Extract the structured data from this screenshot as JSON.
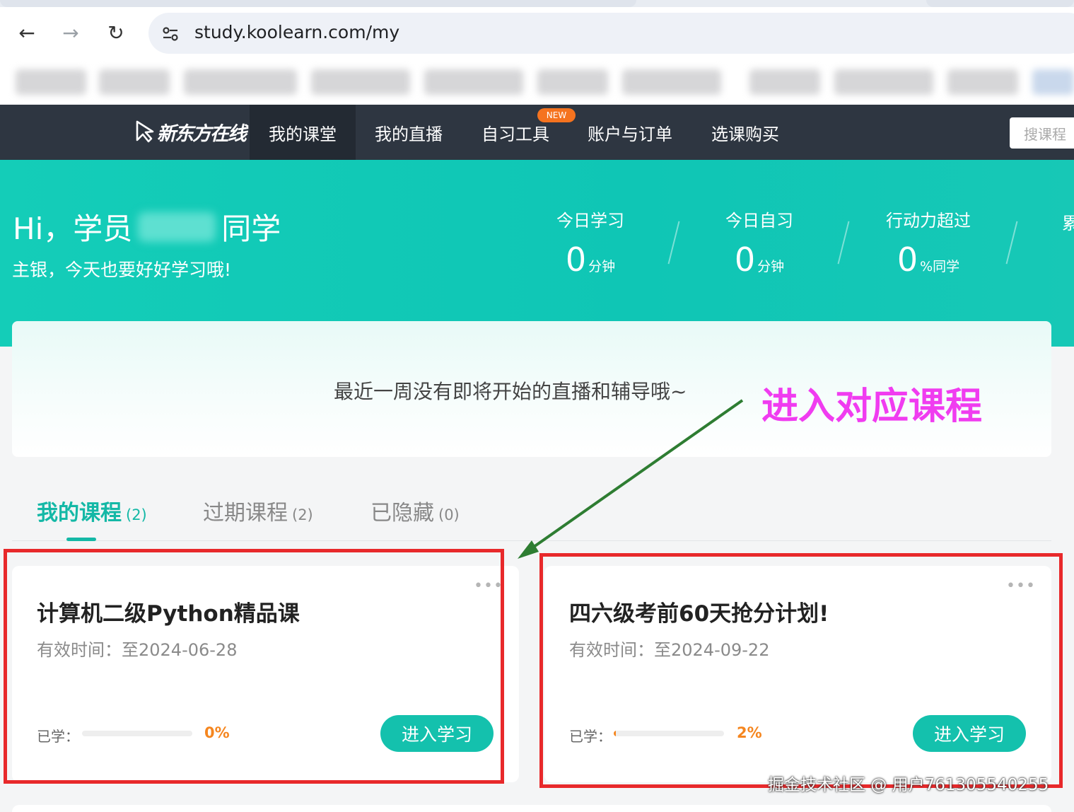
{
  "browser": {
    "url": "study.koolearn.com/my",
    "back_icon": "←",
    "forward_icon": "→",
    "reload_icon": "↻"
  },
  "site": {
    "logo_text": "新东方在线",
    "nav": [
      "我的课堂",
      "我的直播",
      "自习工具",
      "账户与订单",
      "选课购买"
    ],
    "new_badge": "NEW",
    "search_placeholder": "搜课程"
  },
  "hero": {
    "greeting_prefix": "Hi，学员",
    "greeting_suffix": "同学",
    "sub_greeting": "主银，今天也要好好学习哦!",
    "stats": [
      {
        "label": "今日学习",
        "value": "0",
        "unit": "分钟"
      },
      {
        "label": "今日自习",
        "value": "0",
        "unit": "分钟"
      },
      {
        "label": "行动力超过",
        "value": "0",
        "unit": "%同学"
      }
    ],
    "stat_cut": "累"
  },
  "notice": {
    "text": "最近一周没有即将开始的直播和辅导哦~",
    "annotation": "进入对应课程"
  },
  "tabs": [
    {
      "label": "我的课程",
      "count": "(2)"
    },
    {
      "label": "过期课程",
      "count": "(2)"
    },
    {
      "label": "已隐藏",
      "count": "(0)"
    }
  ],
  "courses": [
    {
      "title": "计算机二级Python精品课",
      "valid": "有效时间：至2024-06-28",
      "learned_label": "已学：",
      "progress": 0,
      "progress_text": "0%",
      "button": "进入学习",
      "more": "•••"
    },
    {
      "title": "四六级考前60天抢分计划!",
      "valid": "有效时间：至2024-09-22",
      "learned_label": "已学：",
      "progress": 2,
      "progress_text": "2%",
      "button": "进入学习",
      "more": "•••"
    }
  ],
  "watermark": "掘金技术社区 @ 用户761305540255",
  "colors": {
    "teal": "#14c1ad",
    "nav_bg": "#2e3641",
    "accent_orange": "#f5861f",
    "annotation_pink": "#f03cf0",
    "highlight_red": "#e8292b"
  }
}
